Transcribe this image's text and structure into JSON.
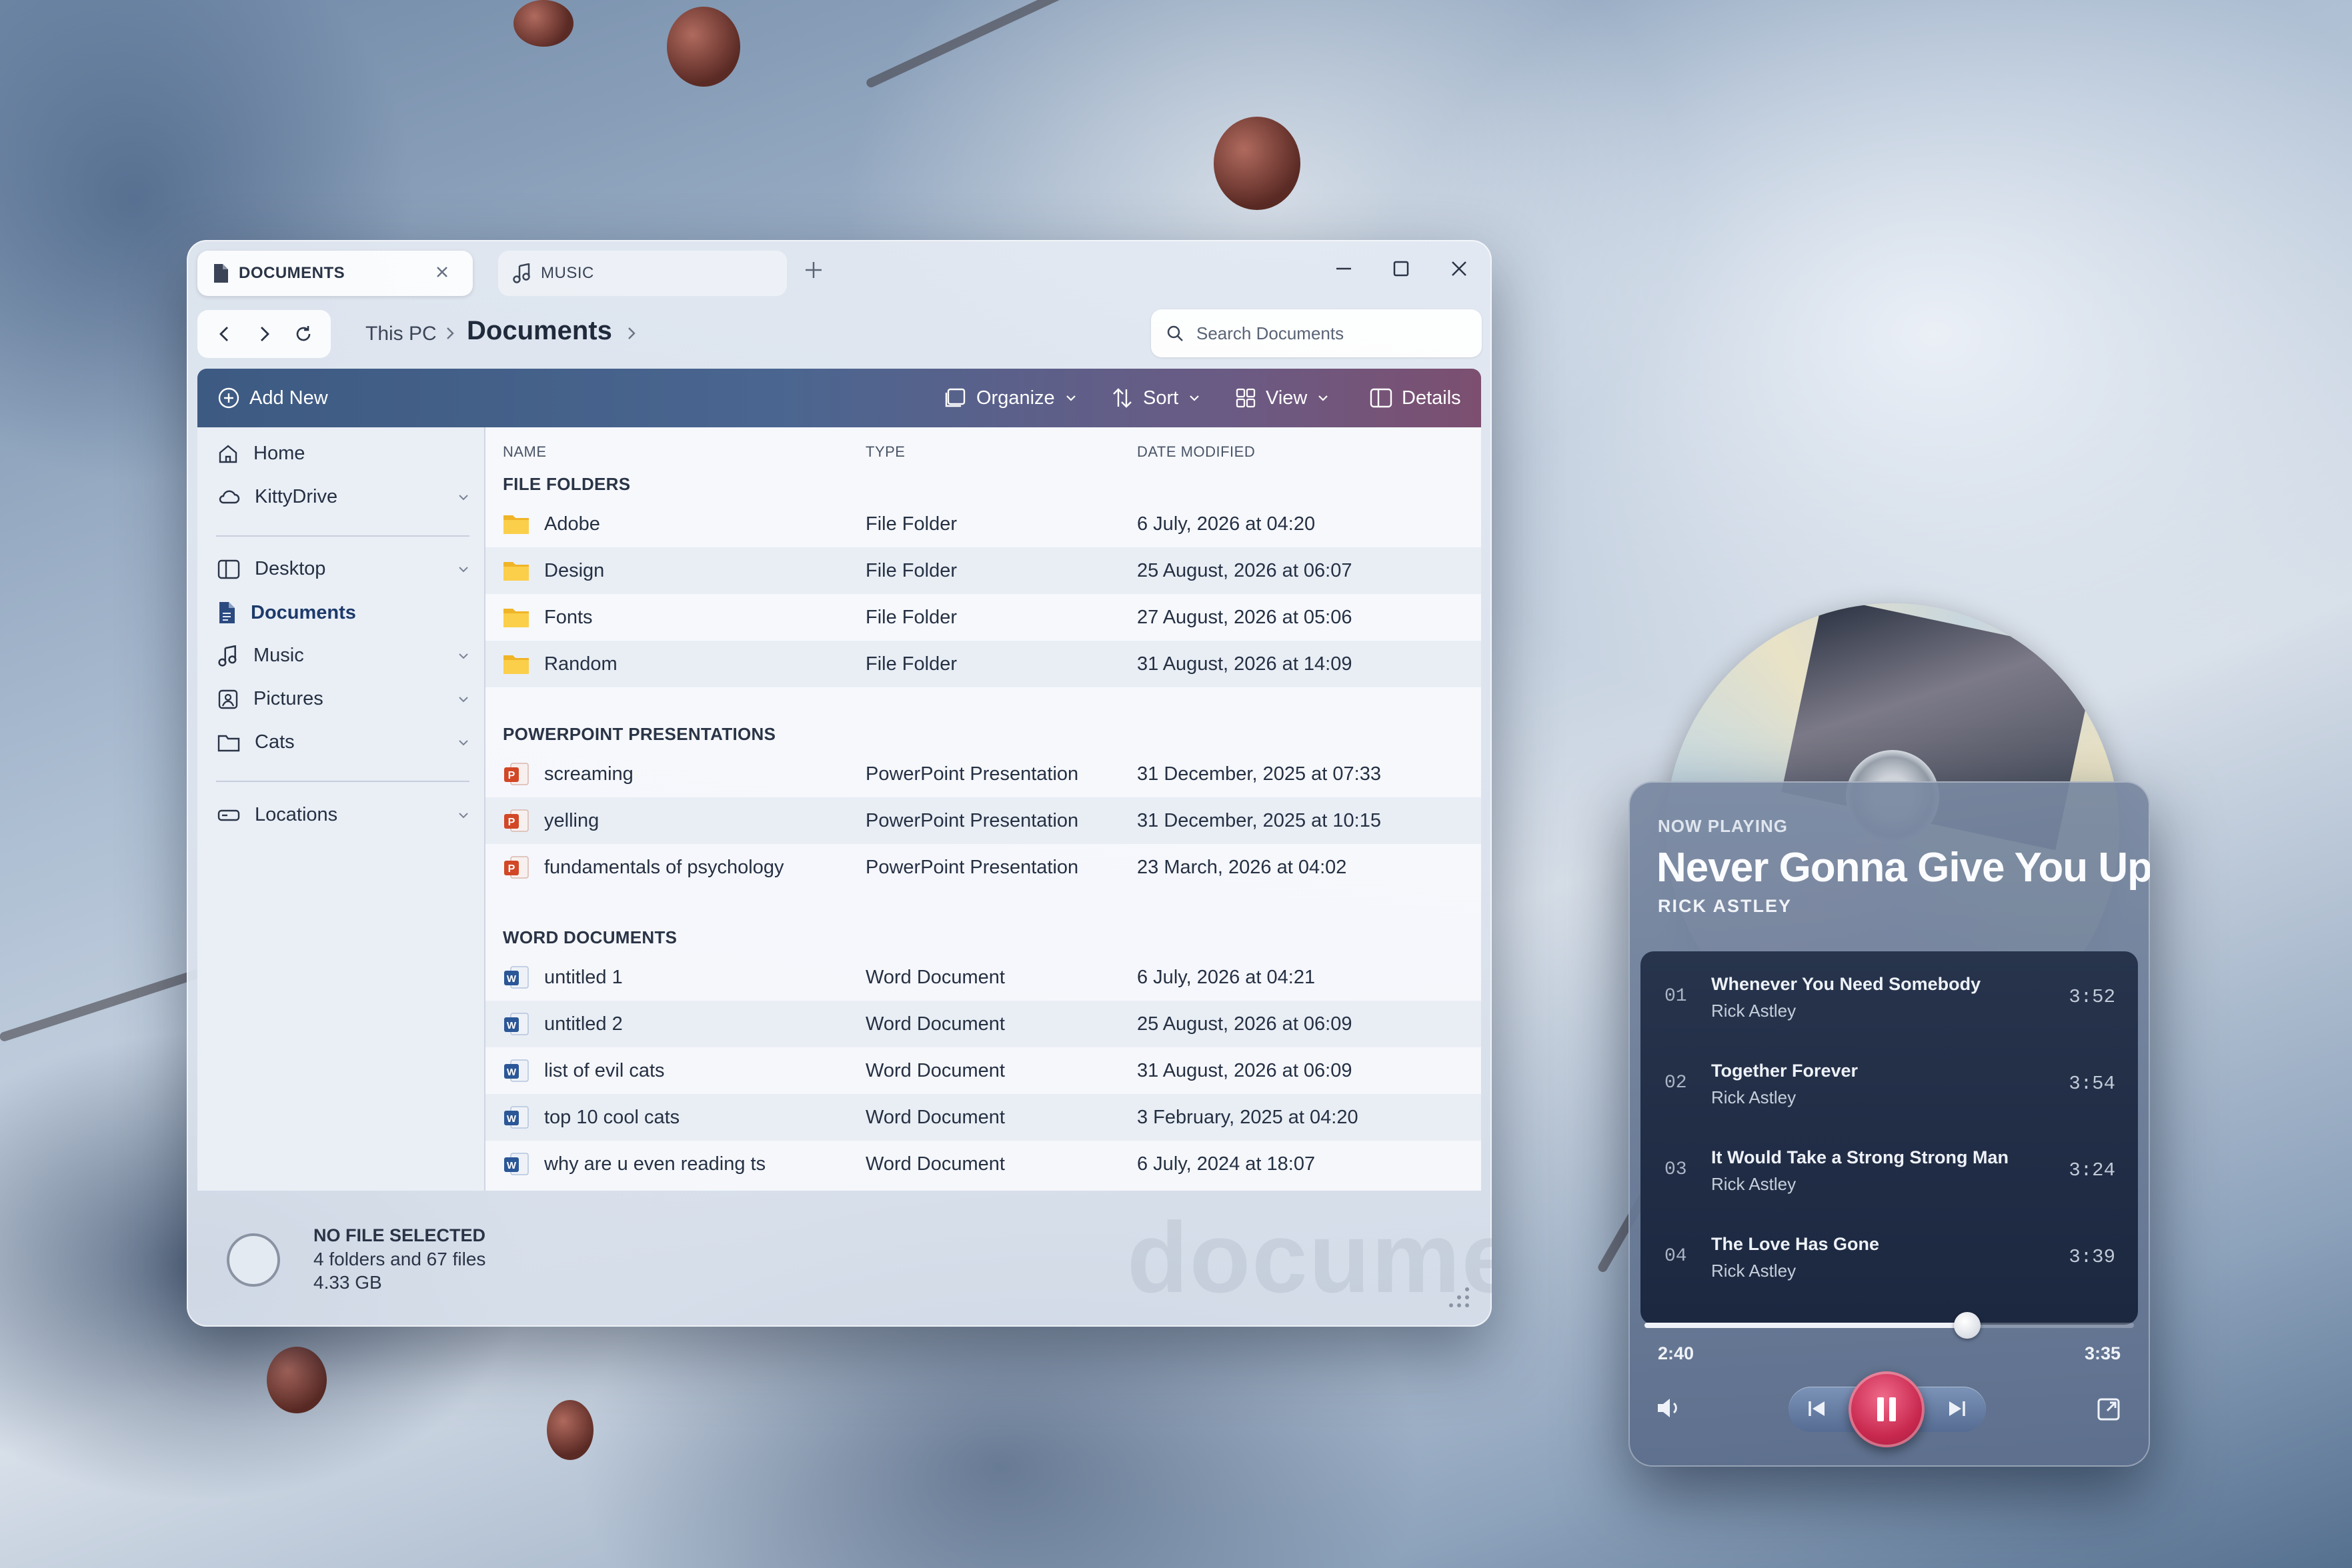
{
  "explorer": {
    "tabs": [
      {
        "label": "DOCUMENTS",
        "active": true
      },
      {
        "label": "MUSIC",
        "active": false
      }
    ],
    "breadcrumb": {
      "root": "This PC",
      "current": "Documents"
    },
    "search": {
      "placeholder": "Search Documents"
    },
    "toolbar": {
      "add_new": "Add New",
      "organize": "Organize",
      "sort": "Sort",
      "view": "View",
      "details": "Details"
    },
    "sidebar": {
      "items": [
        {
          "label": "Home"
        },
        {
          "label": "KittyDrive"
        },
        {
          "label": "Desktop"
        },
        {
          "label": "Documents"
        },
        {
          "label": "Music"
        },
        {
          "label": "Pictures"
        },
        {
          "label": "Cats"
        },
        {
          "label": "Locations"
        }
      ]
    },
    "columns": {
      "name": "NAME",
      "type": "TYPE",
      "date": "DATE MODIFIED"
    },
    "groups": [
      {
        "title": "FILE FOLDERS",
        "rows": [
          {
            "name": "Adobe",
            "type": "File Folder",
            "date": "6 July, 2026 at 04:20"
          },
          {
            "name": "Design",
            "type": "File Folder",
            "date": "25 August, 2026 at 06:07"
          },
          {
            "name": "Fonts",
            "type": "File Folder",
            "date": "27 August, 2026 at 05:06"
          },
          {
            "name": "Random",
            "type": "File Folder",
            "date": "31 August, 2026 at 14:09"
          }
        ]
      },
      {
        "title": "POWERPOINT PRESENTATIONS",
        "rows": [
          {
            "name": "screaming",
            "type": "PowerPoint Presentation",
            "date": "31 December, 2025 at 07:33"
          },
          {
            "name": "yelling",
            "type": "PowerPoint Presentation",
            "date": "31 December, 2025 at 10:15"
          },
          {
            "name": "fundamentals of psychology",
            "type": "PowerPoint Presentation",
            "date": "23 March, 2026 at 04:02"
          }
        ]
      },
      {
        "title": "WORD DOCUMENTS",
        "rows": [
          {
            "name": "untitled 1",
            "type": "Word Document",
            "date": "6 July, 2026 at 04:21"
          },
          {
            "name": "untitled 2",
            "type": "Word Document",
            "date": "25 August, 2026 at 06:09"
          },
          {
            "name": "list of evil cats",
            "type": "Word Document",
            "date": "31 August, 2026 at 06:09"
          },
          {
            "name": "top 10 cool cats",
            "type": "Word Document",
            "date": "3 February, 2025 at 04:20"
          },
          {
            "name": "why are u even reading ts",
            "type": "Word Document",
            "date": "6 July, 2024 at 18:07"
          }
        ]
      }
    ],
    "status": {
      "title": "NO FILE SELECTED",
      "summary": "4 folders and 67 files",
      "size": "4.33 GB"
    },
    "watermark": "documents"
  },
  "player": {
    "label": "NOW PLAYING",
    "title": "Never Gonna Give You Up",
    "artist": "RICK ASTLEY",
    "tracks": [
      {
        "no": "01",
        "title": "Whenever You Need Somebody",
        "artist": "Rick Astley",
        "duration": "3:52"
      },
      {
        "no": "02",
        "title": "Together Forever",
        "artist": "Rick Astley",
        "duration": "3:54"
      },
      {
        "no": "03",
        "title": "It Would Take a Strong Strong Man",
        "artist": "Rick Astley",
        "duration": "3:24"
      },
      {
        "no": "04",
        "title": "The Love Has Gone",
        "artist": "Rick Astley",
        "duration": "3:39"
      }
    ],
    "elapsed": "2:40",
    "total": "3:35",
    "progress_fraction": 0.66
  },
  "colors": {
    "accent_play": "#c8284e",
    "toolbar_start": "#3d5a82",
    "toolbar_end": "#7c4f70"
  }
}
